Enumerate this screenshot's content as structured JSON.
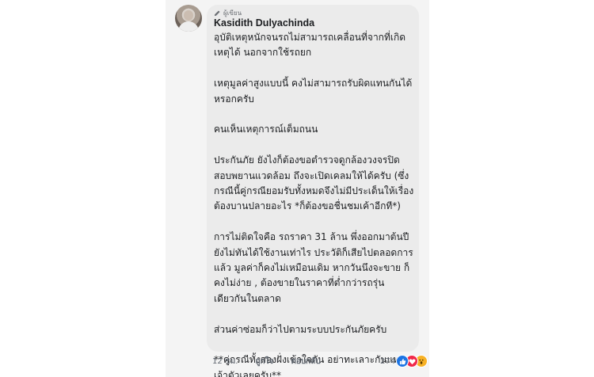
{
  "comment": {
    "badge": "ผู้เขียน",
    "author": "Kasidith Dulyachinda",
    "paragraphs": [
      {
        "lines": [
          "อุบัติเหตุหนักจนรถไม่สามารถเคลื่อนที่จากที่เกิด",
          "เหตุได้ นอกจากใช้รถยก"
        ]
      },
      {
        "lines": [
          "เหตุมูลค่าสูงแบบนี้ คงไม่สามารถรับผิดแทนกันได้",
          "หรอกครับ"
        ]
      },
      {
        "lines": [
          "คนเห็นเหตุการณ์เต็มถนน"
        ]
      },
      {
        "lines": [
          "ประกันภัย  ยังไงก็ต้องขอตำรวจดูกล้องวงจรปิด",
          "สอบพยานแวดล้อม ถึงจะเปิดเคลมให้ได้ครับ  (ซึ่ง",
          "กรณีนี้คู่กรณียอมรับทั้งหมดจึงไม่มีประเด็นให้เรื่อง",
          "ต้องบานปลายอะไร *ก็ต้องขอชื่นชมเค้าอีกที*)"
        ]
      },
      {
        "lines": [
          "การไม่ติดใจคือ รถราคา 31 ล้าน พึ่งออกมาต้นปี",
          "ยังไม่ทันได้ใช้งานเท่าไร ประวัติก็เสียไปตลอดการ",
          "แล้ว มูลค่าก็คงไม่เหมือนเดิม หากวันนึงจะขาย ก็",
          "คงไม่ง่าย  , ต้องขายในราคาที่ต่ำกว่ารถรุ่น",
          "เดียวกันในตลาด"
        ]
      },
      {
        "lines": [
          "ส่วนค่าซ่อมก็ว่าไปตามระบบประกันภัยครับ"
        ]
      },
      {
        "lines": [
          "**คู่กรณีทั้งสองฝั่งเข้าใจกัน อย่าทะเลาะกันแทน",
          "เจ้าตัวเลยครับ**"
        ]
      }
    ],
    "footer": {
      "time": "12 ชม.",
      "like_label": "ถูกใจ",
      "reply_label": "ตอบกลับ"
    },
    "reactions": {
      "count": "274",
      "types": [
        "like",
        "love",
        "wow"
      ]
    }
  },
  "colors": {
    "bubble": "#ebebeb",
    "text": "#1c1e21",
    "meta": "#606770",
    "like": "#1b74e4",
    "love": "#f02849",
    "wow": "#f7b125"
  }
}
